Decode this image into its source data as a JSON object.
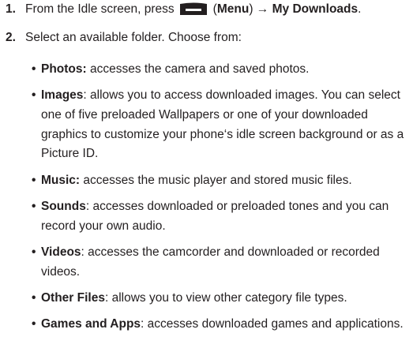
{
  "steps": [
    {
      "number": "1.",
      "prefix": "From the Idle screen, press",
      "key_icon": "menu-softkey-icon",
      "key_paren_open": "(",
      "key_label": "Menu",
      "key_paren_close": ")",
      "arrow": "→",
      "destination": "My Downloads",
      "end": "."
    },
    {
      "number": "2.",
      "text": "Select an available folder. Choose from:"
    }
  ],
  "bullet_char": "•",
  "folders": [
    {
      "title": "Photos:",
      "desc": " accesses the camera and saved photos."
    },
    {
      "title": "Images",
      "desc": ": allows you to access downloaded images. You can select one of five preloaded Wallpapers or one of your downloaded graphics to customize your phone‘s idle screen background or as a Picture ID."
    },
    {
      "title": "Music:",
      "desc": " accesses the music player and stored music files."
    },
    {
      "title": "Sounds",
      "desc": ": accesses downloaded or preloaded tones and you can record your own audio."
    },
    {
      "title": "Videos",
      "desc": ": accesses the camcorder and downloaded or recorded videos."
    },
    {
      "title": "Other Files",
      "desc": ": allows you to view other category file types."
    },
    {
      "title": "Games and Apps",
      "desc": ": accesses downloaded games and applications."
    }
  ]
}
